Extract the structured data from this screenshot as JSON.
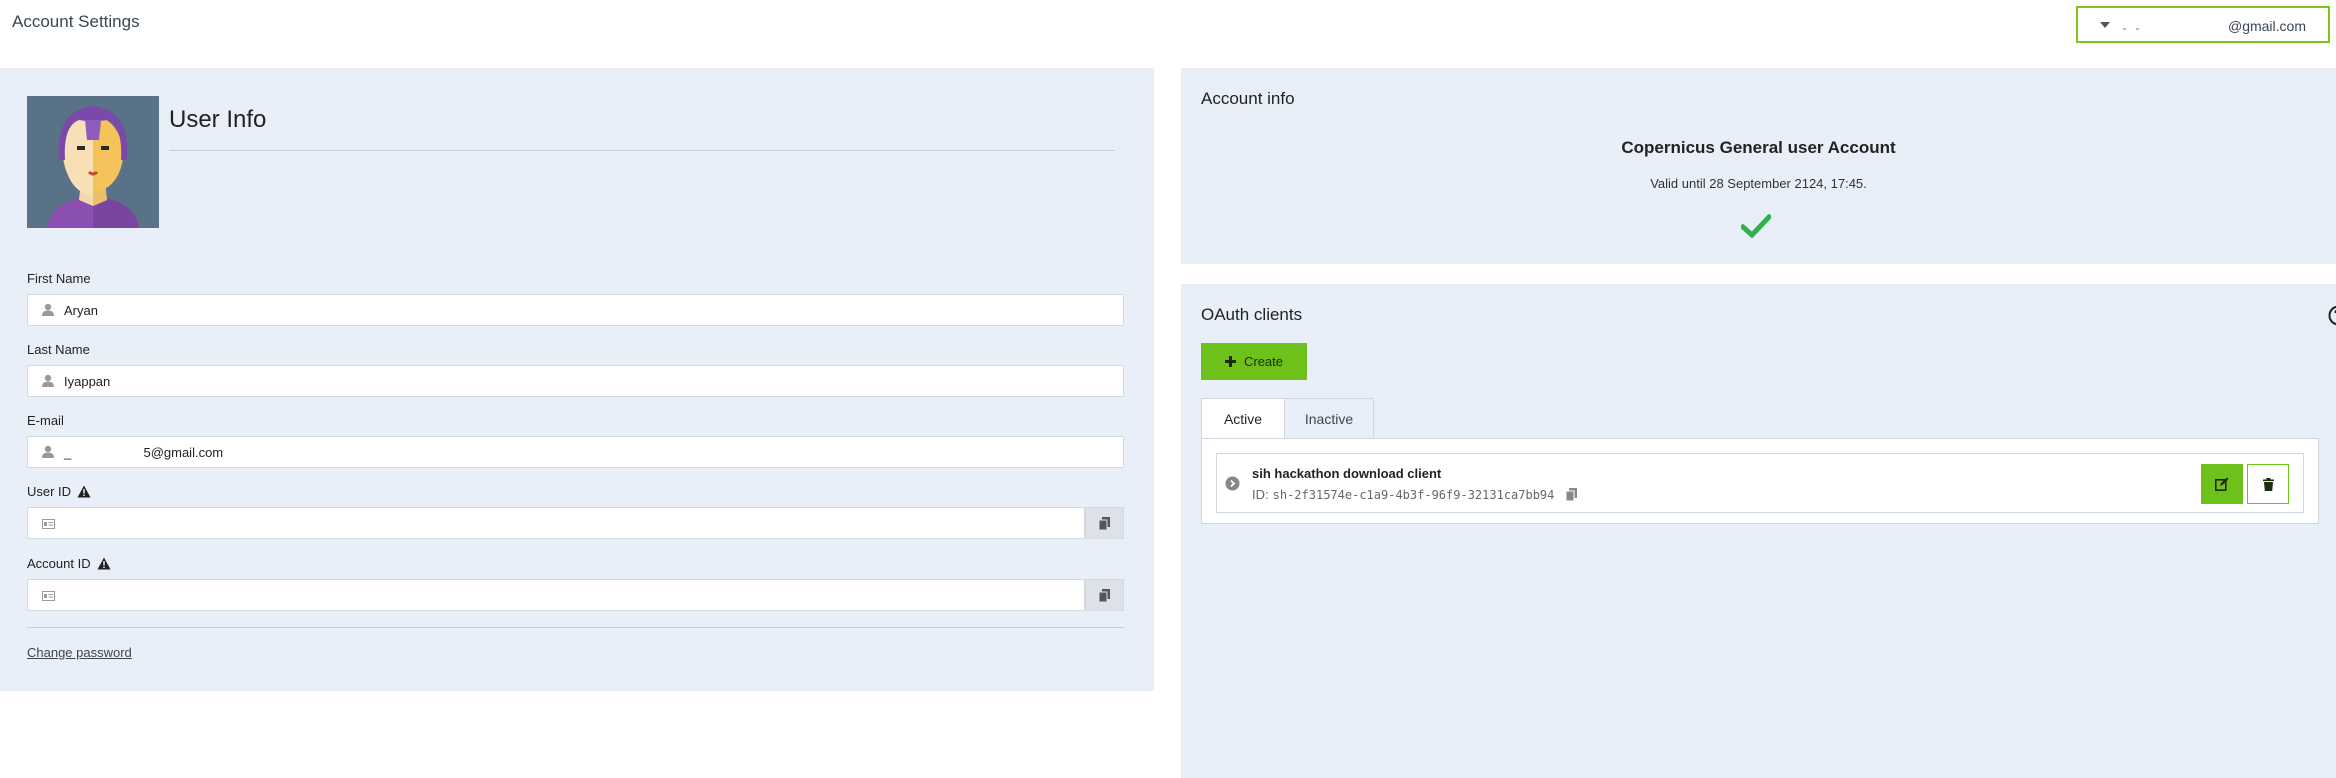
{
  "header": {
    "title": "Account Settings",
    "user_email": "@gmail.com"
  },
  "user_info": {
    "title": "User Info",
    "first_name": {
      "label": "First Name",
      "value": "Aryan"
    },
    "last_name": {
      "label": "Last Name",
      "value": "Iyappan"
    },
    "email": {
      "label": "E-mail",
      "value": "_                    5@gmail.com"
    },
    "user_id": {
      "label": "User ID",
      "value": ""
    },
    "account_id": {
      "label": "Account ID",
      "value": ""
    },
    "change_password": "Change password"
  },
  "account_info": {
    "title": "Account info",
    "account_type": "Copernicus General user Account",
    "valid_until": "Valid until 28 September 2124, 17:45."
  },
  "oauth": {
    "title": "OAuth clients",
    "create_label": "Create",
    "tabs": [
      {
        "label": "Active",
        "selected": true
      },
      {
        "label": "Inactive",
        "selected": false
      }
    ],
    "clients": [
      {
        "name": "sih hackathon download client",
        "id_prefix": "ID:",
        "id": "sh-2f31574e-c1a9-4b3f-96f9-32131ca7bb94"
      }
    ]
  },
  "colors": {
    "accent_green": "#6ec01a",
    "panel_bg": "#e9eff9",
    "check_green": "#2fb24b"
  }
}
